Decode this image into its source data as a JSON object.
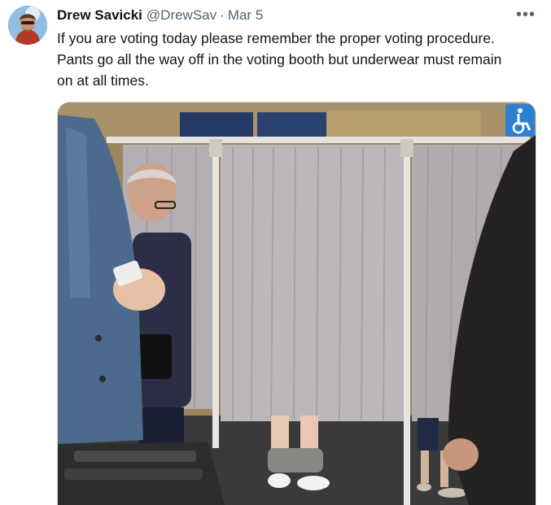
{
  "tweet": {
    "author_name": "Drew Savicki",
    "author_handle": "@DrewSav",
    "separator": "·",
    "date": "Mar 5",
    "more_label": "•••",
    "text": "If you are voting today please remember the proper voting procedure. Pants go all the way off in the voting booth but underwear must remain on at all times."
  },
  "media": {
    "description_icon": "wheelchair-icon",
    "colors": {
      "curtain": "#b7b2b4",
      "wall": "#9b8660",
      "floor": "#3b3a3a",
      "jacket": "#4b6a8e"
    }
  }
}
